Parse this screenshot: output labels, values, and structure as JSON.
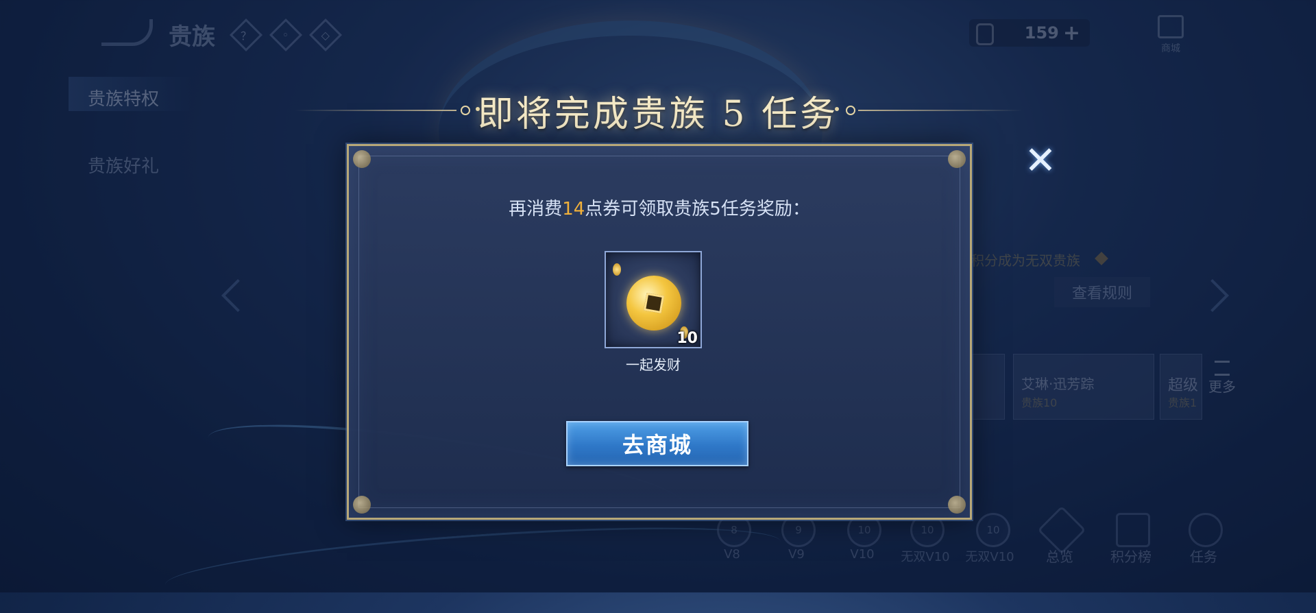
{
  "header": {
    "title": "贵族",
    "help_icon": "？",
    "currency": {
      "value": "159",
      "add": "+"
    },
    "shop_label": "商城"
  },
  "sidebar": {
    "items": [
      {
        "label": "贵族特权",
        "active": true
      },
      {
        "label": "贵族好礼",
        "active": false
      }
    ]
  },
  "background": {
    "tip_text": "积分成为无双贵族",
    "rules_button": "查看规则",
    "hero_name": "艾琳·迅芳踪",
    "hero_sub": "贵族10",
    "super_label": "超级",
    "super_sub": "贵族1",
    "more_label": "更多",
    "levels": [
      "V8",
      "V9",
      "V10",
      "无双V10",
      "无双V10"
    ],
    "badge_numbers": [
      "8",
      "9",
      "10",
      "10",
      "10"
    ],
    "bottom_nav": [
      "总览",
      "积分榜",
      "任务"
    ]
  },
  "modal": {
    "title": "即将完成贵族 5 任务",
    "message_prefix": "再消费",
    "message_highlight": "14",
    "message_suffix": "点券可领取贵族5任务奖励：",
    "reward": {
      "name": "一起发财",
      "count": "10",
      "icon": "gold-coin-icon"
    },
    "button_label": "去商城",
    "close_icon": "✕"
  },
  "colors": {
    "highlight": "#f2b13a",
    "button": "#2f78c8",
    "title_gold": "#f4e9c6"
  }
}
